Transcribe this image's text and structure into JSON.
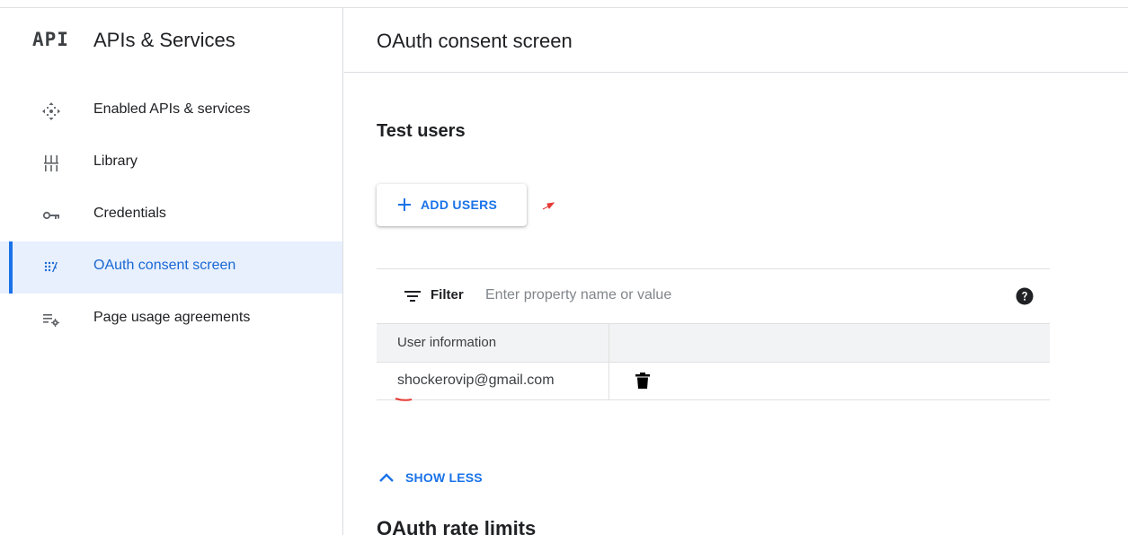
{
  "sidebar": {
    "logo": "API",
    "title": "APIs & Services",
    "items": [
      {
        "label": "Enabled APIs & services",
        "icon": "api-hub-icon",
        "active": false
      },
      {
        "label": "Library",
        "icon": "library-icon",
        "active": false
      },
      {
        "label": "Credentials",
        "icon": "key-icon",
        "active": false
      },
      {
        "label": "OAuth consent screen",
        "icon": "consent-icon",
        "active": true
      },
      {
        "label": "Page usage agreements",
        "icon": "settings-list-icon",
        "active": false
      }
    ]
  },
  "header": {
    "title": "OAuth consent screen"
  },
  "test_users": {
    "title": "Test users",
    "add_users_label": "ADD USERS",
    "filter_label": "Filter",
    "filter_placeholder": "Enter property name or value",
    "filter_value": "",
    "columns": [
      "User information",
      ""
    ],
    "rows": [
      {
        "email": "shockerovip@gmail.com"
      }
    ],
    "show_less_label": "SHOW LESS"
  },
  "rate_limits": {
    "title": "OAuth rate limits"
  },
  "colors": {
    "accent": "#1a73e8",
    "active_bg": "#e8f0fe",
    "annotation_red": "#e53935"
  }
}
